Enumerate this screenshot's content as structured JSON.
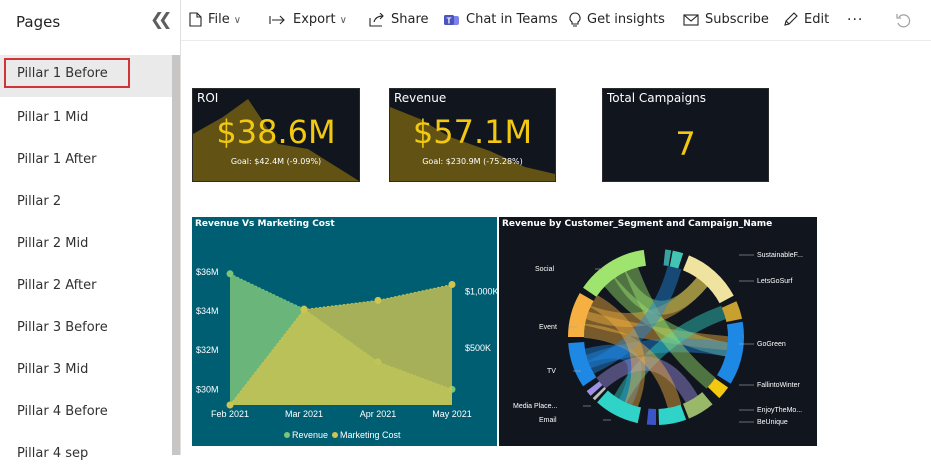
{
  "sidebar": {
    "title": "Pages",
    "items": [
      {
        "label": "Pillar 1 Before"
      },
      {
        "label": "Pillar 1 Mid"
      },
      {
        "label": "Pillar 1 After"
      },
      {
        "label": "Pillar 2"
      },
      {
        "label": "Pillar 2 Mid"
      },
      {
        "label": "Pillar 2 After"
      },
      {
        "label": "Pillar 3 Before"
      },
      {
        "label": "Pillar 3 Mid"
      },
      {
        "label": "Pillar 4 Before"
      },
      {
        "label": "Pillar 4 sep"
      }
    ],
    "active_index": 0
  },
  "toolbar": {
    "file": "File",
    "export": "Export",
    "share": "Share",
    "chat": "Chat in Teams",
    "insights": "Get insights",
    "subscribe": "Subscribe",
    "edit": "Edit",
    "more": "···"
  },
  "kpis": {
    "roi": {
      "title": "ROI",
      "value": "$38.6M",
      "goal": "Goal: $42.4M (-9.09%)"
    },
    "revenue": {
      "title": "Revenue",
      "value": "$57.1M",
      "goal": "Goal: $230.9M (-75.28%)"
    },
    "campaigns": {
      "title": "Total Campaigns",
      "value": "7"
    }
  },
  "colors": {
    "accent": "#f2c811",
    "teal_bg": "#005e73",
    "dark_bg": "#11161e",
    "selection": "#d13438"
  },
  "chart_data": [
    {
      "type": "area",
      "title": "Revenue Vs Marketing Cost",
      "categories": [
        "Feb 2021",
        "Mar 2021",
        "Apr 2021",
        "May 2021"
      ],
      "y_left_ticks": [
        "$36M",
        "$34M",
        "$32M",
        "$30M"
      ],
      "y_right_ticks": [
        "$1,000K",
        "$500K"
      ],
      "ylim_left": [
        29.2,
        36.4
      ],
      "ylim_right": [
        0,
        1240
      ],
      "series": [
        {
          "name": "Revenue",
          "axis": "left",
          "color": "#7cc47a",
          "values": [
            35.9,
            34.1,
            31.4,
            30.0
          ]
        },
        {
          "name": "Marketing Cost",
          "axis": "right",
          "color": "#cfc451",
          "values": [
            0,
            840,
            920,
            1060
          ]
        }
      ],
      "legend_position": "bottom"
    },
    {
      "type": "chord",
      "title": "Revenue by Customer_Segment and Campaign_Name",
      "labels_left": [
        "Social",
        "Event",
        "TV",
        "Media Place...",
        "Email"
      ],
      "labels_right": [
        "SustainableF...",
        "LetsGoSurf",
        "GoGreen",
        "FallintoWinter",
        "EnjoyTheMo...",
        "BeUnique"
      ]
    }
  ]
}
